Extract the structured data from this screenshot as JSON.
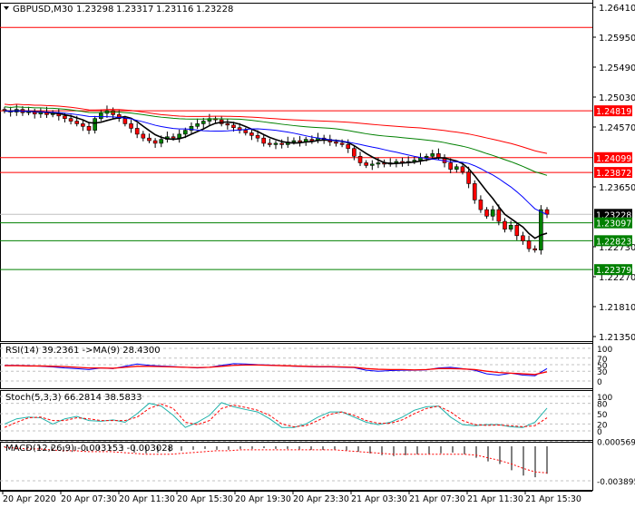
{
  "header": {
    "symbol": "GBPUSD,M30",
    "open": "1.23298",
    "high": "1.23317",
    "low": "1.23116",
    "close": "1.23228"
  },
  "price_axis": [
    "1.26410",
    "1.25950",
    "1.25490",
    "1.25030",
    "1.24570",
    "1.23650",
    "1.22730",
    "1.22270",
    "1.21810",
    "1.21350"
  ],
  "price_labels": [
    {
      "value": "1.24819",
      "color": "#ff0000"
    },
    {
      "value": "1.24099",
      "color": "#ff0000"
    },
    {
      "value": "1.23872",
      "color": "#ff0000"
    },
    {
      "value": "1.23228",
      "color": "#000000"
    },
    {
      "value": "1.23097",
      "color": "#008000"
    },
    {
      "value": "1.22823",
      "color": "#008000"
    },
    {
      "value": "1.22379",
      "color": "#008000"
    }
  ],
  "rsi": {
    "label": "RSI(14) 39.2361   ->MA(9) 28.4300",
    "levels": [
      "100",
      "70",
      "50",
      "30",
      "0"
    ]
  },
  "stoch": {
    "label": "Stoch(5,3,3) 66.2814 38.5833",
    "levels": [
      "100",
      "80",
      "50",
      "20",
      "0"
    ]
  },
  "macd": {
    "label": "MACD(12,26,9) -0.003153 -0.003028",
    "levels": [
      "0.000569",
      "-0.003895"
    ]
  },
  "time_axis": [
    "20 Apr 2020",
    "20 Apr 07:30",
    "20 Apr 11:30",
    "20 Apr 15:30",
    "20 Apr 19:30",
    "20 Apr 23:30",
    "21 Apr 03:30",
    "21 Apr 07:30",
    "21 Apr 11:30",
    "21 Apr 15:30"
  ],
  "colors": {
    "bull": "#008000",
    "bear": "#ff0000",
    "ma_fast": "#000000",
    "ma_mid": "#0000ff",
    "ma_slow": "#008000",
    "ma_long": "#ff0000"
  },
  "chart_data": {
    "type": "candlestick",
    "title": "GBPUSD,M30",
    "ylim": [
      1.2135,
      1.2641
    ],
    "closes": [
      1.2482,
      1.248,
      1.2484,
      1.2479,
      1.2481,
      1.2477,
      1.248,
      1.2476,
      1.2478,
      1.2474,
      1.247,
      1.2466,
      1.2462,
      1.2458,
      1.2452,
      1.247,
      1.2478,
      1.2482,
      1.2476,
      1.247,
      1.2462,
      1.2455,
      1.2446,
      1.244,
      1.2436,
      1.2432,
      1.2438,
      1.2442,
      1.244,
      1.2446,
      1.2452,
      1.2458,
      1.2462,
      1.2466,
      1.247,
      1.2468,
      1.2462,
      1.246,
      1.2456,
      1.2452,
      1.2448,
      1.2444,
      1.244,
      1.2432,
      1.243,
      1.2432,
      1.243,
      1.2434,
      1.2436,
      1.2434,
      1.2438,
      1.2436,
      1.244,
      1.2438,
      1.2434,
      1.2432,
      1.243,
      1.2424,
      1.2412,
      1.2402,
      1.2398,
      1.24,
      1.2402,
      1.24,
      1.2402,
      1.2404,
      1.2402,
      1.2404,
      1.2406,
      1.241,
      1.2412,
      1.2416,
      1.241,
      1.2402,
      1.2392,
      1.2396,
      1.2388,
      1.237,
      1.2345,
      1.233,
      1.232,
      1.233,
      1.2312,
      1.23,
      1.2306,
      1.229,
      1.2282,
      1.227,
      1.2268,
      1.233,
      1.2323
    ],
    "hlines": [
      {
        "price": 1.261,
        "color": "#ff0000"
      },
      {
        "price": 1.24819,
        "color": "#ff0000"
      },
      {
        "price": 1.24099,
        "color": "#ff0000"
      },
      {
        "price": 1.23872,
        "color": "#ff0000"
      },
      {
        "price": 1.23228,
        "color": "#c0c0c0"
      },
      {
        "price": 1.23097,
        "color": "#008000"
      },
      {
        "price": 1.22823,
        "color": "#008000"
      },
      {
        "price": 1.22379,
        "color": "#008000"
      }
    ],
    "rsi": [
      48,
      48,
      47,
      45,
      43,
      40,
      38,
      35,
      40,
      38,
      45,
      52,
      48,
      46,
      44,
      42,
      40,
      42,
      48,
      53,
      52,
      50,
      49,
      47,
      45,
      44,
      43,
      43,
      42,
      41,
      33,
      30,
      32,
      33,
      33,
      34,
      40,
      42,
      38,
      33,
      22,
      18,
      24,
      18,
      16,
      38
    ],
    "rsi_ma": [
      47,
      47,
      46,
      46,
      45,
      44,
      42,
      40,
      40,
      39,
      42,
      45,
      45,
      44,
      43,
      42,
      41,
      42,
      45,
      48,
      49,
      49,
      48,
      47,
      46,
      45,
      44,
      44,
      43,
      42,
      38,
      36,
      35,
      35,
      34,
      35,
      38,
      38,
      37,
      35,
      30,
      26,
      24,
      22,
      20,
      28
    ],
    "stoch_main": [
      20,
      35,
      40,
      38,
      20,
      35,
      42,
      30,
      28,
      32,
      25,
      50,
      80,
      72,
      45,
      10,
      25,
      45,
      82,
      70,
      62,
      55,
      35,
      10,
      10,
      20,
      40,
      55,
      55,
      40,
      25,
      18,
      25,
      40,
      60,
      70,
      72,
      40,
      18,
      15,
      18,
      18,
      12,
      10,
      25,
      66
    ],
    "stoch_signal": [
      10,
      25,
      38,
      40,
      30,
      30,
      38,
      35,
      30,
      30,
      30,
      40,
      65,
      78,
      65,
      25,
      18,
      30,
      65,
      75,
      68,
      60,
      45,
      20,
      12,
      15,
      30,
      48,
      55,
      45,
      30,
      22,
      22,
      32,
      50,
      65,
      72,
      55,
      30,
      18,
      16,
      17,
      15,
      12,
      15,
      38
    ],
    "macd_hist": [
      -0.0001,
      -0.0001,
      -0.0002,
      -0.0003,
      -0.0004,
      -0.0004,
      -0.0005,
      -0.0005,
      -0.0004,
      -0.0003,
      -0.0005,
      -0.0007,
      -0.0008,
      -0.0007,
      -0.0006,
      -0.0005,
      -0.0004,
      -0.0003,
      -0.0004,
      -0.0004,
      -0.0003,
      -0.0003,
      -0.0002,
      -0.0003,
      -0.0003,
      -0.0004,
      -0.0004,
      -0.0004,
      -0.0004,
      -0.0005,
      -0.0006,
      -0.0008,
      -0.001,
      -0.0011,
      -0.001,
      -0.0009,
      -0.0009,
      -0.0008,
      -0.0007,
      -0.0009,
      -0.0013,
      -0.0017,
      -0.002,
      -0.0027,
      -0.0033,
      -0.0035,
      -0.0031
    ],
    "macd_signal": [
      -0.0001,
      -0.0002,
      -0.0003,
      -0.0003,
      -0.0004,
      -0.0005,
      -0.0005,
      -0.0006,
      -0.0006,
      -0.0006,
      -0.0007,
      -0.0008,
      -0.0009,
      -0.0009,
      -0.0009,
      -0.0008,
      -0.0007,
      -0.0006,
      -0.0005,
      -0.0005,
      -0.0004,
      -0.0004,
      -0.0004,
      -0.0004,
      -0.0004,
      -0.0004,
      -0.0004,
      -0.0004,
      -0.0004,
      -0.0005,
      -0.0006,
      -0.0007,
      -0.0008,
      -0.0009,
      -0.0009,
      -0.0009,
      -0.0009,
      -0.0009,
      -0.0009,
      -0.0009,
      -0.001,
      -0.0013,
      -0.0016,
      -0.002,
      -0.0025,
      -0.0029,
      -0.003
    ]
  }
}
